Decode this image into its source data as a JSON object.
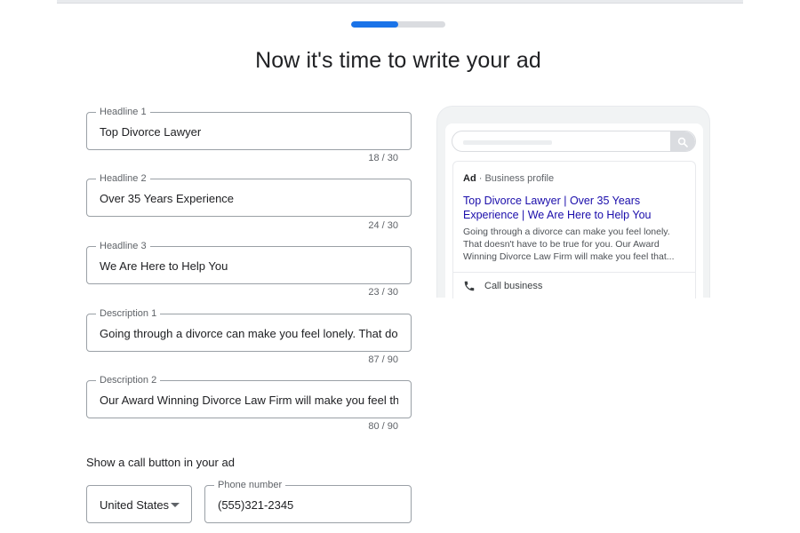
{
  "progress": {
    "fraction": 0.5
  },
  "page_title": "Now it's time to write your ad",
  "fields": [
    {
      "label": "Headline 1",
      "value": "Top Divorce Lawyer",
      "counter": "18 / 30"
    },
    {
      "label": "Headline 2",
      "value": "Over 35 Years Experience",
      "counter": "24 / 30"
    },
    {
      "label": "Headline 3",
      "value": "We Are Here to Help You",
      "counter": "23 / 30"
    },
    {
      "label": "Description 1",
      "value": "Going through a divorce can make you feel lonely. That doesn'",
      "counter": "87 / 90"
    },
    {
      "label": "Description 2",
      "value": "Our Award Winning Divorce Law Firm will make you feel that s",
      "counter": "80 / 90"
    }
  ],
  "call_section": {
    "label": "Show a call button in your ad",
    "country": "United States",
    "phone_label": "Phone number",
    "phone_value": "(555)321-2345"
  },
  "preview": {
    "ad_tag": "Ad",
    "separator": "·",
    "profile": "Business profile",
    "headline": "Top Divorce Lawyer | Over 35 Years Experience | We Are Here to Help You",
    "description": "Going through a divorce can make you feel lonely. That doesn't have to be true for you. Our Award Winning Divorce Law Firm will make you feel that...",
    "call_label": "Call business"
  },
  "colors": {
    "accent": "#1a73e8",
    "ad_link": "#1a0dab"
  }
}
